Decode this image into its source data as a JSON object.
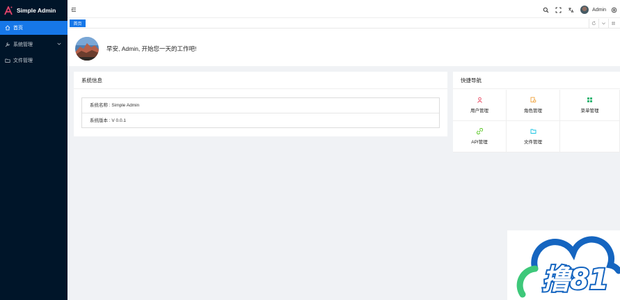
{
  "app": {
    "title": "Simple Admin"
  },
  "sidebar": {
    "items": [
      {
        "label": "首页",
        "icon": "home-icon",
        "active": true
      },
      {
        "label": "系统管理",
        "icon": "wrench-icon",
        "expandable": true
      },
      {
        "label": "文件管理",
        "icon": "folder-icon"
      }
    ]
  },
  "header": {
    "user": "Admin",
    "icons": [
      "menu-toggle-icon",
      "search-icon",
      "fullscreen-icon",
      "translate-icon",
      "avatar",
      "settings-icon"
    ]
  },
  "tabs": {
    "items": [
      {
        "label": "首页",
        "active": true
      }
    ],
    "actions": [
      "refresh-icon",
      "chevron-down-icon",
      "expand-icon"
    ]
  },
  "welcome": {
    "text": "早安, Admin, 开始您一天的工作吧!"
  },
  "system_card": {
    "title": "系统信息",
    "rows": [
      {
        "text": "系统名称 : Simple Admin"
      },
      {
        "text": "系统版本 : V 0.0.1"
      }
    ]
  },
  "nav_card": {
    "title": "快捷导航",
    "items": [
      {
        "label": "用户管理",
        "icon": "user-icon",
        "color": "#e8455f"
      },
      {
        "label": "角色管理",
        "icon": "role-icon",
        "color": "#f0a23a"
      },
      {
        "label": "菜单管理",
        "icon": "grid-icon",
        "color": "#2bb673"
      },
      {
        "label": "API管理",
        "icon": "link-icon",
        "color": "#52c41a"
      },
      {
        "label": "文件管理",
        "icon": "folder-icon",
        "color": "#13c2e2"
      }
    ]
  },
  "watermark": {
    "text": "撸81"
  },
  "colors": {
    "sidebar_bg": "#001529",
    "accent": "#1677e8",
    "content_bg": "#f0f2f5"
  }
}
